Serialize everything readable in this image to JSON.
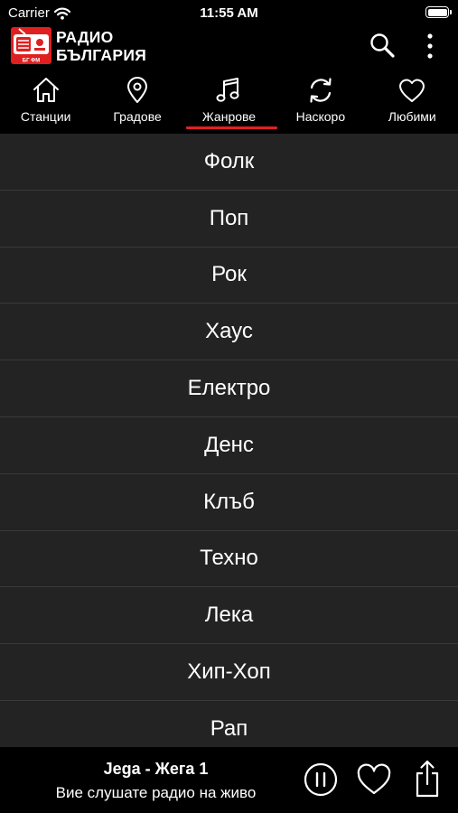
{
  "status_bar": {
    "carrier": "Carrier",
    "time": "11:55 AM"
  },
  "header": {
    "logo_line1": "РАДИО",
    "logo_line2": "БЪЛГАРИЯ",
    "logo_badge": "БГ ФМ",
    "icons": [
      "search-icon",
      "more-vertical-icon"
    ]
  },
  "tabs": [
    {
      "label": "Станции",
      "icon": "home-icon",
      "active": false
    },
    {
      "label": "Градове",
      "icon": "location-pin-icon",
      "active": false
    },
    {
      "label": "Жанрове",
      "icon": "music-note-icon",
      "active": true
    },
    {
      "label": "Наскоро",
      "icon": "refresh-icon",
      "active": false
    },
    {
      "label": "Любими",
      "icon": "heart-icon",
      "active": false
    }
  ],
  "genres": [
    "Фолк",
    "Поп",
    "Рок",
    "Хаус",
    "Електро",
    "Денс",
    "Клъб",
    "Техно",
    "Лека",
    "Хип-Хоп",
    "Рап"
  ],
  "player": {
    "track": "Jega - Жега 1",
    "subtitle": "Вие слушате радио на живо",
    "icons": [
      "pause-icon",
      "heart-icon",
      "share-icon"
    ]
  },
  "colors": {
    "accent": "#e02020",
    "list_background": "#232323",
    "background": "#000000"
  }
}
